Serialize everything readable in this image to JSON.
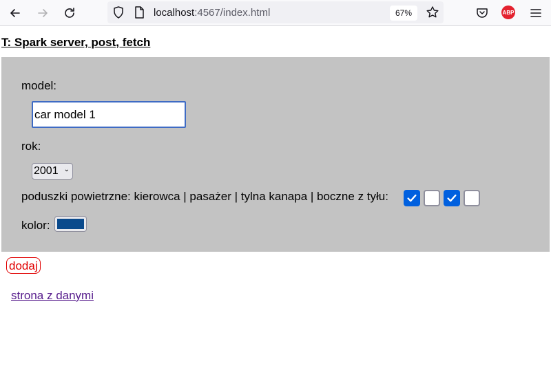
{
  "browser": {
    "url_host": "localhost",
    "url_rest": ":4567/index.html",
    "zoom": "67%",
    "abp_label": "ABP"
  },
  "page": {
    "title": "T: Spark server, post, fetch"
  },
  "form": {
    "model_label": "model:",
    "model_value": "car model 1",
    "year_label": "rok:",
    "year_selected": "2001",
    "airbags_label": "poduszki powietrzne: kierowca | pasażer | tylna kanapa | boczne z tyłu:",
    "airbags": [
      true,
      false,
      true,
      false
    ],
    "color_label": "kolor:",
    "color_value": "#0a4a8c"
  },
  "actions": {
    "add_button": "dodaj",
    "data_link": "strona z danymi"
  },
  "colors": {
    "panel_bg": "#c3c3c3",
    "checkbox_on": "#0060df",
    "button_red": "#e00000",
    "link_visited": "#551a8b"
  }
}
